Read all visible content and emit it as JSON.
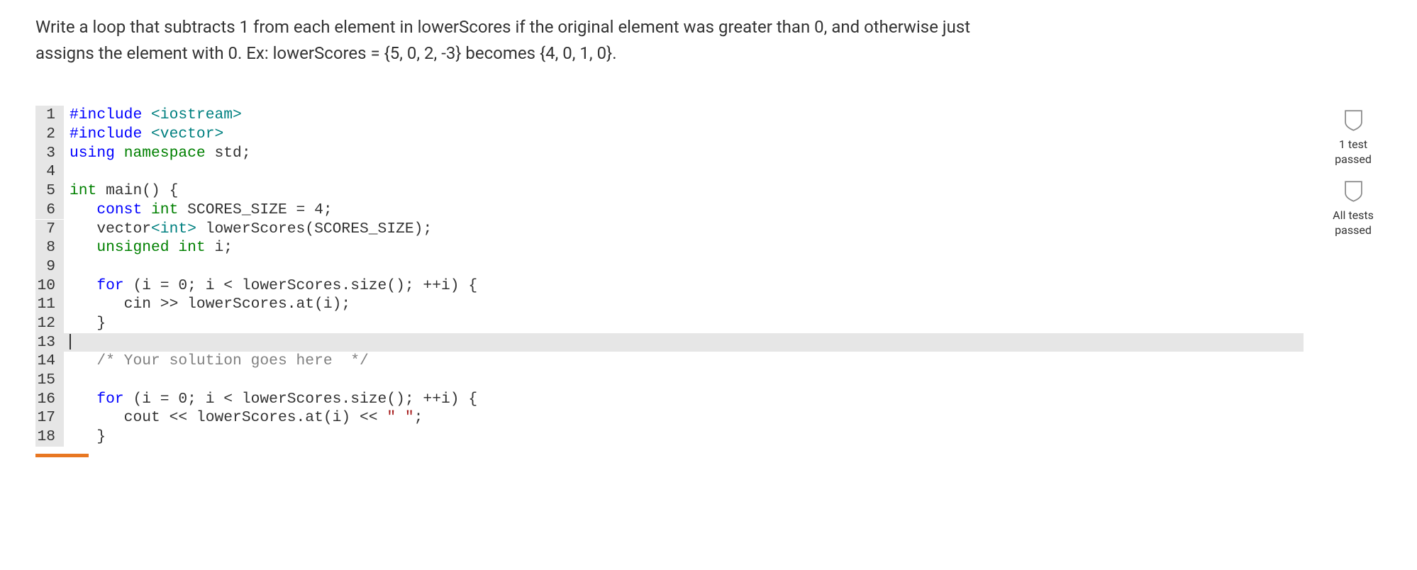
{
  "prompt": {
    "line1": "Write a loop that subtracts 1 from each element in lowerScores if the original element was greater than 0, and otherwise just",
    "line2": "assigns the element with 0. Ex: lowerScores = {5, 0, 2, -3} becomes {4, 0, 1, 0}."
  },
  "code": {
    "lines": [
      {
        "num": "1",
        "tokens": [
          {
            "t": "#include ",
            "c": "kw-blue"
          },
          {
            "t": "<iostream>",
            "c": "kw-teal"
          }
        ]
      },
      {
        "num": "2",
        "tokens": [
          {
            "t": "#include ",
            "c": "kw-blue"
          },
          {
            "t": "<vector>",
            "c": "kw-teal"
          }
        ]
      },
      {
        "num": "3",
        "tokens": [
          {
            "t": "using ",
            "c": "kw-blue"
          },
          {
            "t": "namespace ",
            "c": "kw-green"
          },
          {
            "t": "std;",
            "c": ""
          }
        ]
      },
      {
        "num": "4",
        "tokens": []
      },
      {
        "num": "5",
        "tokens": [
          {
            "t": "int ",
            "c": "kw-green"
          },
          {
            "t": "main() {",
            "c": ""
          }
        ]
      },
      {
        "num": "6",
        "tokens": [
          {
            "t": "   ",
            "c": ""
          },
          {
            "t": "const ",
            "c": "kw-blue"
          },
          {
            "t": "int ",
            "c": "kw-green"
          },
          {
            "t": "SCORES_SIZE = 4;",
            "c": ""
          }
        ]
      },
      {
        "num": "7",
        "tokens": [
          {
            "t": "   vector",
            "c": ""
          },
          {
            "t": "<int>",
            "c": "kw-teal"
          },
          {
            "t": " lowerScores(SCORES_SIZE);",
            "c": ""
          }
        ]
      },
      {
        "num": "8",
        "tokens": [
          {
            "t": "   ",
            "c": ""
          },
          {
            "t": "unsigned ",
            "c": "kw-green"
          },
          {
            "t": "int ",
            "c": "kw-green"
          },
          {
            "t": "i;",
            "c": ""
          }
        ]
      },
      {
        "num": "9",
        "tokens": []
      },
      {
        "num": "10",
        "tokens": [
          {
            "t": "   ",
            "c": ""
          },
          {
            "t": "for",
            "c": "kw-blue"
          },
          {
            "t": " (i = 0; i < lowerScores.size(); ++i) {",
            "c": ""
          }
        ]
      },
      {
        "num": "11",
        "tokens": [
          {
            "t": "      cin >> lowerScores.at(i);",
            "c": ""
          }
        ]
      },
      {
        "num": "12",
        "tokens": [
          {
            "t": "   }",
            "c": ""
          }
        ]
      },
      {
        "num": "13",
        "tokens": [],
        "highlighted": true,
        "cursor": true
      },
      {
        "num": "14",
        "tokens": [
          {
            "t": "   ",
            "c": ""
          },
          {
            "t": "/* Your solution goes here  */",
            "c": "comment"
          }
        ]
      },
      {
        "num": "15",
        "tokens": []
      },
      {
        "num": "16",
        "tokens": [
          {
            "t": "   ",
            "c": ""
          },
          {
            "t": "for",
            "c": "kw-blue"
          },
          {
            "t": " (i = 0; i < lowerScores.size(); ++i) {",
            "c": ""
          }
        ]
      },
      {
        "num": "17",
        "tokens": [
          {
            "t": "      cout << lowerScores.at(i) << ",
            "c": ""
          },
          {
            "t": "\" \"",
            "c": "string"
          },
          {
            "t": ";",
            "c": ""
          }
        ]
      },
      {
        "num": "18",
        "tokens": [
          {
            "t": "   }",
            "c": ""
          }
        ]
      }
    ]
  },
  "status": {
    "test1_line1": "1 test",
    "test1_line2": "passed",
    "alltests_line1": "All tests",
    "alltests_line2": "passed"
  }
}
